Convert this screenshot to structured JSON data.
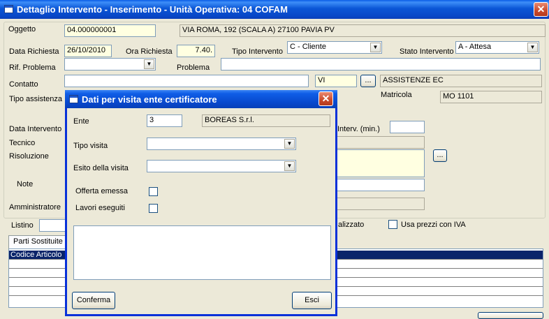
{
  "window": {
    "title": "Dettaglio Intervento - Inserimento - Unità Operativa: 04 COFAM",
    "close_glyph": "✕"
  },
  "main": {
    "oggetto_label": "Oggetto",
    "oggetto_value": "04.000000001",
    "address_value": "VIA ROMA, 192 (SCALA A) 27100 PAVIA PV",
    "data_richiesta_label": "Data Richiesta",
    "data_richiesta_value": "26/10/2010",
    "ora_richiesta_label": "Ora Richiesta",
    "ora_richiesta_value": "7.40.",
    "tipo_intervento_label": "Tipo Intervento",
    "tipo_intervento_value": "C - Cliente",
    "stato_intervento_label": "Stato Intervento",
    "stato_intervento_value": "A - Attesa",
    "rif_problema_label": "Rif. Problema",
    "rif_problema_value": "",
    "problema_label": "Problema",
    "problema_value": "",
    "contatto_label": "Contatto",
    "contatto_value": "",
    "vi_value": "VI",
    "browse_label": "...",
    "assistenze_value": "ASSISTENZE EC",
    "tipo_assistenza_label": "Tipo assistenza",
    "matricola_label": "Matricola",
    "matricola_value": "MO 1101",
    "data_intervento_label": "Data Intervento",
    "interv_min_label": "Interv. (min.)",
    "interv_min_value": "",
    "tecnico_label": "Tecnico",
    "risoluzione_label": "Risoluzione",
    "risoluzione_browse": "...",
    "note_label": "Note",
    "amministratore_label": "Amministratore",
    "listino_label": "Listino",
    "listino_value": "",
    "alizzato_label": "alizzato",
    "usa_prezzi_label": "Usa prezzi con IVA",
    "parti_sostituite_tab": "Parti Sostituite",
    "grid_header_codice": "Codice Articolo"
  },
  "dialog": {
    "title": "Dati per visita ente certificatore",
    "close_glyph": "✕",
    "ente_label": "Ente",
    "ente_value": "3",
    "ente_name": "BOREAS S.r.l.",
    "tipo_visita_label": "Tipo visita",
    "tipo_visita_value": "",
    "esito_label": "Esito della visita",
    "esito_value": "",
    "offerta_label": "Offerta emessa",
    "offerta_checked": false,
    "lavori_label": "Lavori eseguiti",
    "lavori_checked": false,
    "notes_value": "",
    "conferma_label": "Conferma",
    "esci_label": "Esci"
  }
}
